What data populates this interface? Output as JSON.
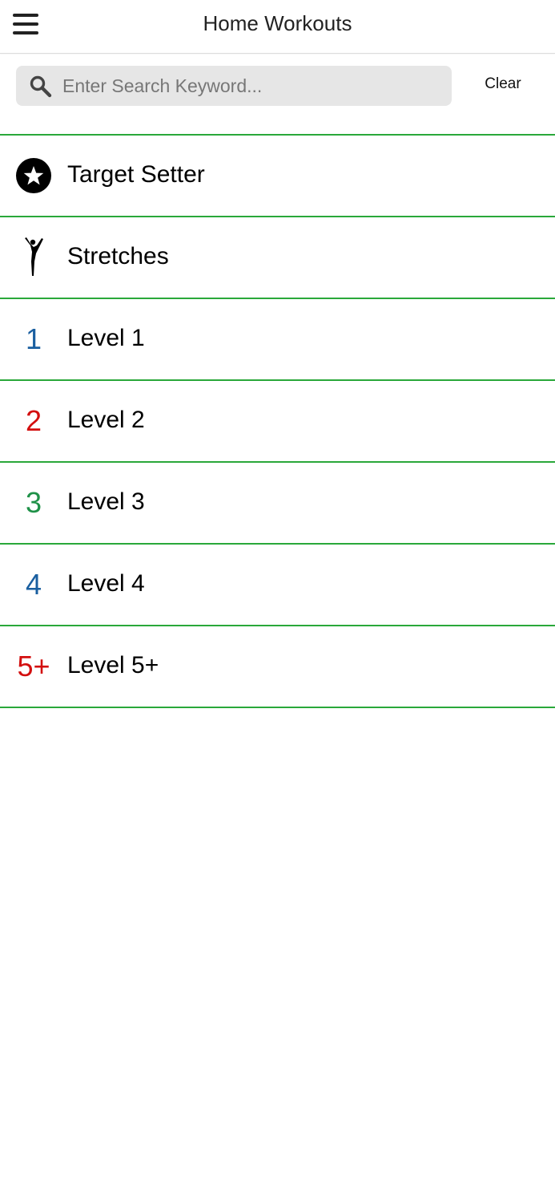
{
  "header": {
    "title": "Home Workouts",
    "menu_icon": "hamburger-menu-icon"
  },
  "search": {
    "placeholder": "Enter Search Keyword...",
    "value": "",
    "icon": "search-icon",
    "clear_label": "Clear"
  },
  "list": {
    "divider_color": "#2aa83a",
    "items": [
      {
        "label": "Target Setter",
        "icon": "star-circle-icon"
      },
      {
        "label": "Stretches",
        "icon": "stretching-figure-icon"
      },
      {
        "label": "Level 1",
        "icon_text": "1",
        "icon_color": "#1a5fa0"
      },
      {
        "label": "Level 2",
        "icon_text": "2",
        "icon_color": "#d30f0f"
      },
      {
        "label": "Level 3",
        "icon_text": "3",
        "icon_color": "#1f9148"
      },
      {
        "label": "Level 4",
        "icon_text": "4",
        "icon_color": "#1a5fa0"
      },
      {
        "label": "Level 5+",
        "icon_text": "5+",
        "icon_color": "#d30f0f"
      }
    ]
  }
}
